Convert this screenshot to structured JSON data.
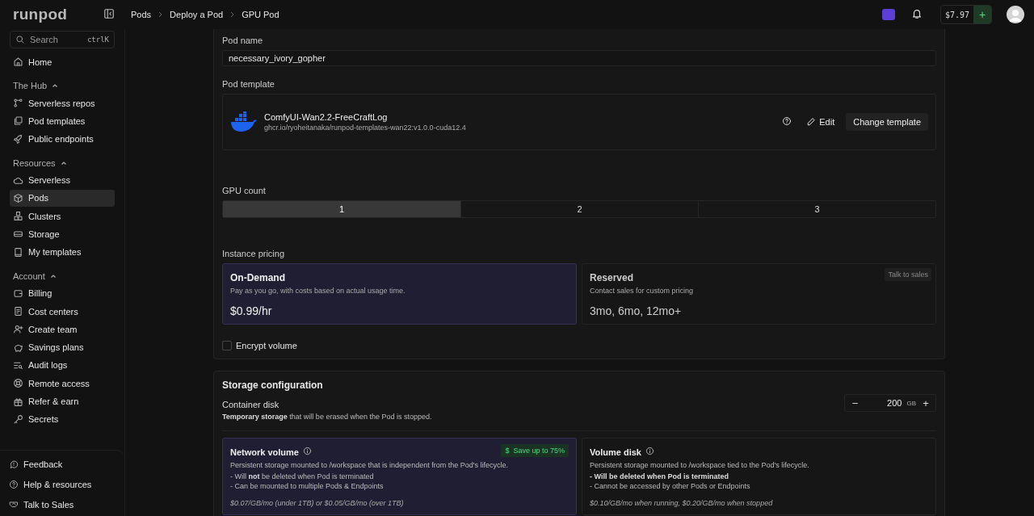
{
  "brand": "runpod",
  "breadcrumbs": [
    "Pods",
    "Deploy a Pod",
    "GPU Pod"
  ],
  "top_bar": {
    "balance": "$7.97",
    "add": "+"
  },
  "sidebar": {
    "search": {
      "placeholder": "Search",
      "shortcut": "ctrlK"
    },
    "home": {
      "label": "Home",
      "selected": false
    },
    "sections": [
      {
        "title": "The Hub",
        "expanded": true,
        "items": [
          {
            "label": "Serverless repos",
            "selected": false
          },
          {
            "label": "Pod templates",
            "selected": false
          },
          {
            "label": "Public endpoints",
            "selected": false
          }
        ]
      },
      {
        "title": "Resources",
        "expanded": true,
        "items": [
          {
            "label": "Serverless",
            "selected": false
          },
          {
            "label": "Pods",
            "selected": true
          },
          {
            "label": "Clusters",
            "selected": false
          },
          {
            "label": "Storage",
            "selected": false
          },
          {
            "label": "My templates",
            "selected": false
          }
        ]
      },
      {
        "title": "Account",
        "expanded": true,
        "items": [
          {
            "label": "Billing",
            "selected": false
          },
          {
            "label": "Cost centers",
            "selected": false
          },
          {
            "label": "Create team",
            "selected": false
          },
          {
            "label": "Savings plans",
            "selected": false
          },
          {
            "label": "Audit logs",
            "selected": false
          },
          {
            "label": "Remote access",
            "selected": false
          },
          {
            "label": "Refer & earn",
            "selected": false
          },
          {
            "label": "Secrets",
            "selected": false
          }
        ]
      }
    ],
    "footer": [
      "Feedback",
      "Help & resources",
      "Talk to Sales"
    ]
  },
  "pod_name": {
    "label": "Pod name",
    "value": "necessary_ivory_gopher"
  },
  "pod_template": {
    "label": "Pod template",
    "name": "ComfyUI-Wan2.2-FreeCraftLog",
    "image": "ghcr.io/ryoheitanaka/runpod-templates-wan22:v1.0.0-cuda12.4",
    "edit": "Edit",
    "change": "Change template"
  },
  "gpu_count": {
    "label": "GPU count",
    "options": [
      {
        "label": "1",
        "selected": true
      },
      {
        "label": "2",
        "selected": false
      },
      {
        "label": "3",
        "selected": false
      }
    ]
  },
  "instance_pricing": {
    "label": "Instance pricing",
    "options": [
      {
        "title": "On-Demand",
        "description": "Pay as you go, with costs based on actual usage time.",
        "price": "$0.99/hr",
        "selected": true
      },
      {
        "title": "Reserved",
        "description": "Contact sales for custom pricing",
        "price": "3mo, 6mo, 12mo+",
        "badge": "Talk to sales",
        "selected": false
      }
    ]
  },
  "encrypt_volume": {
    "label": "Encrypt volume",
    "checked": false
  },
  "storage": {
    "title": "Storage configuration",
    "container_disk": {
      "label": "Container disk",
      "description": "**Temporary storage** that will be erased when the Pod is stopped.",
      "value": "200",
      "unit": "GB",
      "minus": "−",
      "plus": "+"
    },
    "volumes": [
      {
        "title": "Network volume",
        "badge_icon": "$",
        "badge": "Save up to 75%",
        "description": "Persistent storage mounted to /workspace that is independent from the Pod's lifecycle.",
        "lines": [
          {
            "text": "- Will **not** be deleted when Pod is terminated",
            "emphasis": false
          },
          {
            "text": "- Can be mounted to multiple Pods & Endpoints",
            "emphasis": false
          }
        ],
        "price": "$0.07/GB/mo (under 1TB) or $0.05/GB/mo (over 1TB)",
        "selected": true
      },
      {
        "title": "Volume disk",
        "description": "Persistent storage mounted to /workspace tied to the Pod's lifecycle.",
        "lines": [
          {
            "text": "- Will be deleted when Pod is terminated",
            "emphasis": true
          },
          {
            "text": "- Cannot be accessed by other Pods or Endpoints",
            "emphasis": false
          }
        ],
        "price": "$0.10/GB/mo when running, $0.20/GB/mo when stopped",
        "selected": false
      }
    ]
  }
}
